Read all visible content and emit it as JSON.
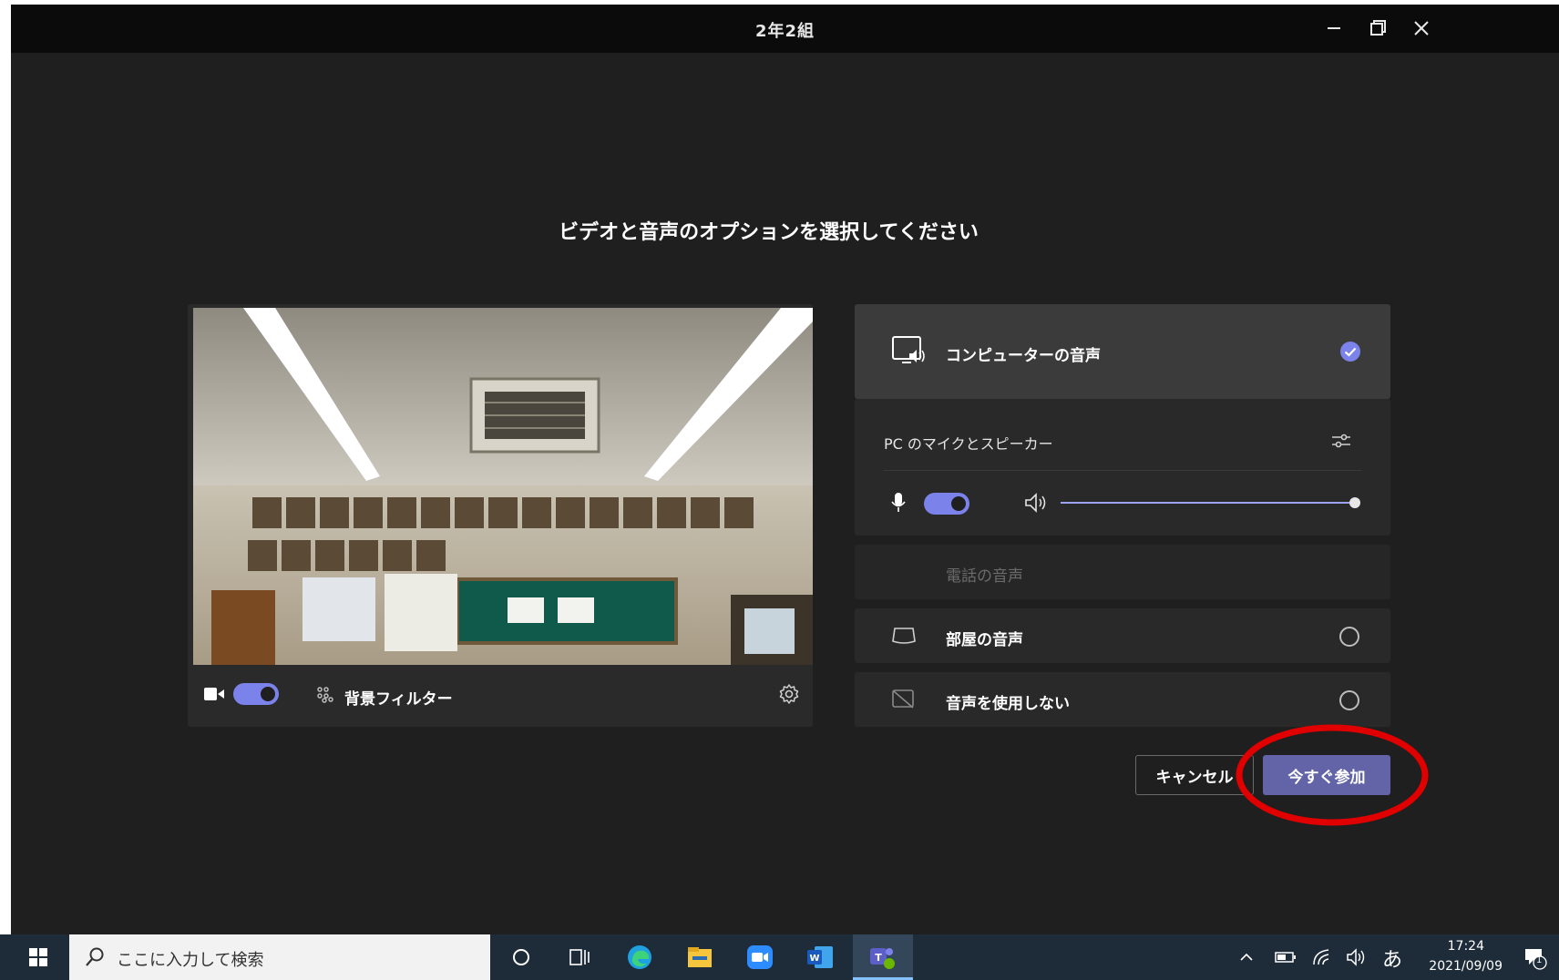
{
  "window": {
    "title": "2年2組",
    "heading": "ビデオと音声のオプションを選択してください"
  },
  "video": {
    "background_filter_label": "背景フィルター",
    "camera_on": true
  },
  "audio": {
    "computer_audio": {
      "label": "コンピューターの音声",
      "selected": true
    },
    "device_label": "PC のマイクとスピーカー",
    "mic_on": true,
    "speaker_volume_percent": 100,
    "phone_audio": {
      "label": "電話の音声"
    },
    "room_audio": {
      "label": "部屋の音声",
      "selected": false
    },
    "no_audio": {
      "label": "音声を使用しない",
      "selected": false
    }
  },
  "actions": {
    "cancel_label": "キャンセル",
    "join_label": "今すぐ参加"
  },
  "taskbar": {
    "search_placeholder": "ここに入力して検索",
    "ime_label": "あ",
    "clock_time": "17:24",
    "clock_date": "2021/09/09",
    "notification_count": "1"
  },
  "colors": {
    "accent": "#6264a7",
    "toggle": "#7b83eb",
    "highlight": "#e00000"
  }
}
